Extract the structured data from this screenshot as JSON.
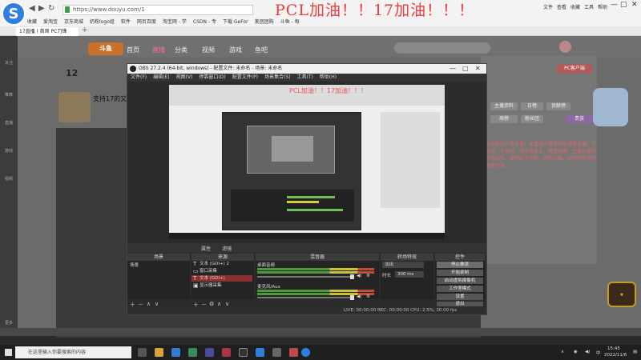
{
  "browser": {
    "url": "https://www.douyu.com/1",
    "banner_text": "PCL加油！！17加油！！！",
    "bookmarks": [
      "收藏",
      "爱淘宝",
      "京东商城",
      "奶粉logo组",
      "软件",
      "网页百度",
      "淘宝网 - 学",
      "CSDN - 专",
      "下载 GeFor",
      "美团团购",
      "斗鱼 - 每"
    ],
    "tab_label": "17直播丨首席 PC刀锋",
    "right_menu": [
      "文件",
      "查看",
      "收藏",
      "工具",
      "帮助"
    ]
  },
  "douyu": {
    "logo": "斗鱼",
    "nav": [
      "首页",
      "直播",
      "分类",
      "视频",
      "游戏",
      "鱼吧"
    ],
    "count": "12",
    "room_title": "支持17的又一",
    "pc_button": "PC客户端",
    "right_buttons": [
      "主播资料",
      "日榜",
      "贡献榜",
      "周榜",
      "粉丝团",
      "贵族"
    ],
    "notice_text": "欢迎来到斗鱼直播！本直播间倡导绿色健康直播，不低俗、不违规，请文明发言，理性消费。主播仅提供娱乐陪伴，请勿私下交易，谨防诈骗，共同营造良好直播环境。",
    "sidebar": [
      "关注",
      "推荐",
      "直播",
      "游戏",
      "视频",
      "更多"
    ]
  },
  "obs": {
    "title": "OBS 27.2.4 (64-bit, windows) - 配置文件: 未命名 - 场景: 未命名",
    "menu": [
      "文件(F)",
      "编辑(E)",
      "视图(V)",
      "停靠窗口(D)",
      "配置文件(P)",
      "场景集合(S)",
      "工具(T)",
      "帮助(H)"
    ],
    "preview_banner": "PCL加油！！17加油！！！",
    "dock_bar_labels": [
      "属性",
      "滤镜"
    ],
    "docks": {
      "scenes": "场景",
      "sources": "来源",
      "mixer": "混音器",
      "transitions": "转场特效",
      "controls": "控件"
    },
    "scene_items": [
      "场景"
    ],
    "source_items": [
      "文本 (GDI+) 2",
      "窗口采集",
      "文本 (GDI+)",
      "显示器采集"
    ],
    "mixer_channels": [
      {
        "name": "桌面音频",
        "db": "0.0 dB"
      },
      {
        "name": "麦克风/Aux",
        "db": "0.0 dB"
      }
    ],
    "transition": {
      "type": "淡出",
      "duration_label": "时长",
      "duration": "300 ms"
    },
    "controls": [
      "停止推流",
      "开始录制",
      "启动虚拟摄像机",
      "工作室模式",
      "设置",
      "退出"
    ],
    "status": "LIVE: 00:00:00   REC: 00:00:00   CPU: 2.5%, 30.00 fps"
  },
  "taskbar": {
    "search_placeholder": "在这里输入你要搜索的内容",
    "time": "15:45",
    "date": "2022/11/6",
    "lang": "中"
  }
}
